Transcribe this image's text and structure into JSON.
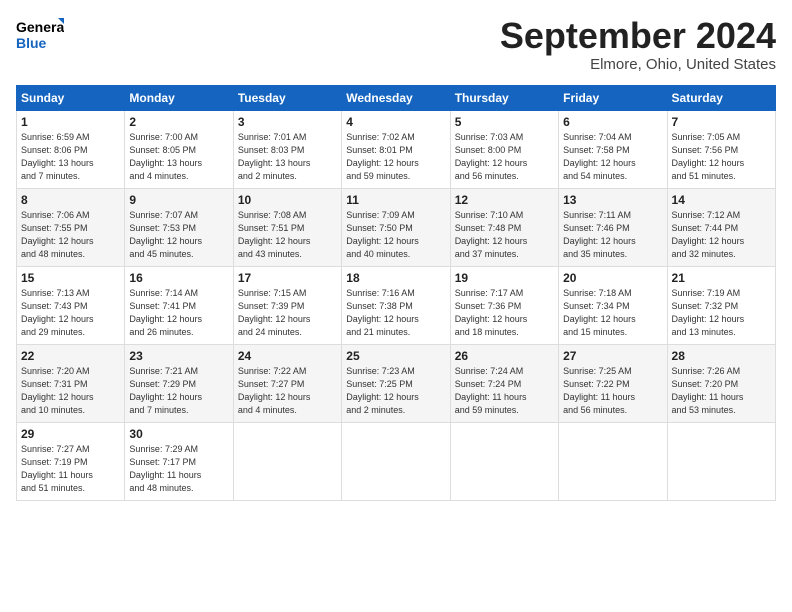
{
  "logo": {
    "line1": "General",
    "line2": "Blue"
  },
  "title": "September 2024",
  "subtitle": "Elmore, Ohio, United States",
  "days_header": [
    "Sunday",
    "Monday",
    "Tuesday",
    "Wednesday",
    "Thursday",
    "Friday",
    "Saturday"
  ],
  "weeks": [
    [
      {
        "day": "1",
        "info": "Sunrise: 6:59 AM\nSunset: 8:06 PM\nDaylight: 13 hours\nand 7 minutes."
      },
      {
        "day": "2",
        "info": "Sunrise: 7:00 AM\nSunset: 8:05 PM\nDaylight: 13 hours\nand 4 minutes."
      },
      {
        "day": "3",
        "info": "Sunrise: 7:01 AM\nSunset: 8:03 PM\nDaylight: 13 hours\nand 2 minutes."
      },
      {
        "day": "4",
        "info": "Sunrise: 7:02 AM\nSunset: 8:01 PM\nDaylight: 12 hours\nand 59 minutes."
      },
      {
        "day": "5",
        "info": "Sunrise: 7:03 AM\nSunset: 8:00 PM\nDaylight: 12 hours\nand 56 minutes."
      },
      {
        "day": "6",
        "info": "Sunrise: 7:04 AM\nSunset: 7:58 PM\nDaylight: 12 hours\nand 54 minutes."
      },
      {
        "day": "7",
        "info": "Sunrise: 7:05 AM\nSunset: 7:56 PM\nDaylight: 12 hours\nand 51 minutes."
      }
    ],
    [
      {
        "day": "8",
        "info": "Sunrise: 7:06 AM\nSunset: 7:55 PM\nDaylight: 12 hours\nand 48 minutes."
      },
      {
        "day": "9",
        "info": "Sunrise: 7:07 AM\nSunset: 7:53 PM\nDaylight: 12 hours\nand 45 minutes."
      },
      {
        "day": "10",
        "info": "Sunrise: 7:08 AM\nSunset: 7:51 PM\nDaylight: 12 hours\nand 43 minutes."
      },
      {
        "day": "11",
        "info": "Sunrise: 7:09 AM\nSunset: 7:50 PM\nDaylight: 12 hours\nand 40 minutes."
      },
      {
        "day": "12",
        "info": "Sunrise: 7:10 AM\nSunset: 7:48 PM\nDaylight: 12 hours\nand 37 minutes."
      },
      {
        "day": "13",
        "info": "Sunrise: 7:11 AM\nSunset: 7:46 PM\nDaylight: 12 hours\nand 35 minutes."
      },
      {
        "day": "14",
        "info": "Sunrise: 7:12 AM\nSunset: 7:44 PM\nDaylight: 12 hours\nand 32 minutes."
      }
    ],
    [
      {
        "day": "15",
        "info": "Sunrise: 7:13 AM\nSunset: 7:43 PM\nDaylight: 12 hours\nand 29 minutes."
      },
      {
        "day": "16",
        "info": "Sunrise: 7:14 AM\nSunset: 7:41 PM\nDaylight: 12 hours\nand 26 minutes."
      },
      {
        "day": "17",
        "info": "Sunrise: 7:15 AM\nSunset: 7:39 PM\nDaylight: 12 hours\nand 24 minutes."
      },
      {
        "day": "18",
        "info": "Sunrise: 7:16 AM\nSunset: 7:38 PM\nDaylight: 12 hours\nand 21 minutes."
      },
      {
        "day": "19",
        "info": "Sunrise: 7:17 AM\nSunset: 7:36 PM\nDaylight: 12 hours\nand 18 minutes."
      },
      {
        "day": "20",
        "info": "Sunrise: 7:18 AM\nSunset: 7:34 PM\nDaylight: 12 hours\nand 15 minutes."
      },
      {
        "day": "21",
        "info": "Sunrise: 7:19 AM\nSunset: 7:32 PM\nDaylight: 12 hours\nand 13 minutes."
      }
    ],
    [
      {
        "day": "22",
        "info": "Sunrise: 7:20 AM\nSunset: 7:31 PM\nDaylight: 12 hours\nand 10 minutes."
      },
      {
        "day": "23",
        "info": "Sunrise: 7:21 AM\nSunset: 7:29 PM\nDaylight: 12 hours\nand 7 minutes."
      },
      {
        "day": "24",
        "info": "Sunrise: 7:22 AM\nSunset: 7:27 PM\nDaylight: 12 hours\nand 4 minutes."
      },
      {
        "day": "25",
        "info": "Sunrise: 7:23 AM\nSunset: 7:25 PM\nDaylight: 12 hours\nand 2 minutes."
      },
      {
        "day": "26",
        "info": "Sunrise: 7:24 AM\nSunset: 7:24 PM\nDaylight: 11 hours\nand 59 minutes."
      },
      {
        "day": "27",
        "info": "Sunrise: 7:25 AM\nSunset: 7:22 PM\nDaylight: 11 hours\nand 56 minutes."
      },
      {
        "day": "28",
        "info": "Sunrise: 7:26 AM\nSunset: 7:20 PM\nDaylight: 11 hours\nand 53 minutes."
      }
    ],
    [
      {
        "day": "29",
        "info": "Sunrise: 7:27 AM\nSunset: 7:19 PM\nDaylight: 11 hours\nand 51 minutes."
      },
      {
        "day": "30",
        "info": "Sunrise: 7:29 AM\nSunset: 7:17 PM\nDaylight: 11 hours\nand 48 minutes."
      },
      {
        "day": "",
        "info": ""
      },
      {
        "day": "",
        "info": ""
      },
      {
        "day": "",
        "info": ""
      },
      {
        "day": "",
        "info": ""
      },
      {
        "day": "",
        "info": ""
      }
    ]
  ]
}
